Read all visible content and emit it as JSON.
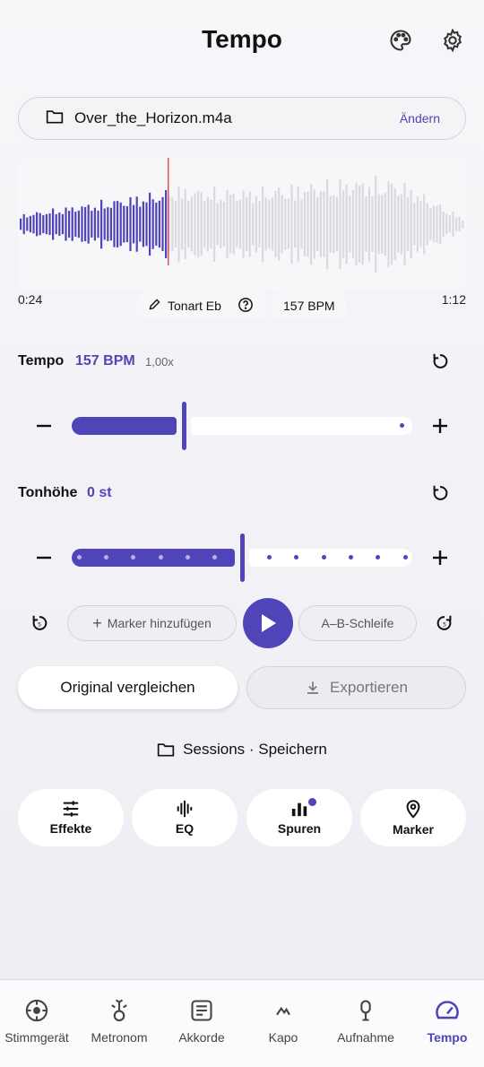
{
  "header": {
    "title": "Tempo",
    "palette_icon": "palette-icon",
    "settings_icon": "gear-icon"
  },
  "file": {
    "name": "Over_the_Horizon.m4a",
    "change_label": "Ändern",
    "icon": "folder-icon"
  },
  "waveform": {
    "progress": 0.333,
    "played_color": "#4f44b8",
    "unplayed_color": "#d9d9de",
    "playhead_color": "#e05555"
  },
  "playback": {
    "position": "0:24",
    "duration": "1:12"
  },
  "chips": {
    "key_label": "Tonart Eb",
    "bpm_label": "157 BPM"
  },
  "tempo": {
    "label": "Tempo",
    "value": "157 BPM",
    "rate": "1,00x",
    "level": 0.33
  },
  "pitch": {
    "label": "Tonhöhe",
    "value": "0 st",
    "level": 0.5
  },
  "transport": {
    "add_marker_label": "Marker hinzufügen",
    "ab_loop_label": "A–B-Schleife"
  },
  "actions": {
    "compare_label": "Original vergleichen",
    "export_label": "Exportieren"
  },
  "sessions": {
    "label": "Sessions · Speichern"
  },
  "features": [
    {
      "label": "Effekte",
      "icon": "sliders-icon"
    },
    {
      "label": "EQ",
      "icon": "equalizer-icon"
    },
    {
      "label": "Spuren",
      "icon": "tracks-icon",
      "badge": true
    },
    {
      "label": "Marker",
      "icon": "location-pin-icon"
    }
  ],
  "nav": [
    {
      "label": "Stimmgerät",
      "icon": "tuner-icon"
    },
    {
      "label": "Metronom",
      "icon": "metronome-icon"
    },
    {
      "label": "Akkorde",
      "icon": "chords-icon"
    },
    {
      "label": "Kapo",
      "icon": "capo-icon"
    },
    {
      "label": "Aufnahme",
      "icon": "microphone-icon"
    },
    {
      "label": "Tempo",
      "icon": "speedometer-icon",
      "active": true
    }
  ],
  "colors": {
    "accent": "#4f44b8",
    "text": "#111111"
  }
}
